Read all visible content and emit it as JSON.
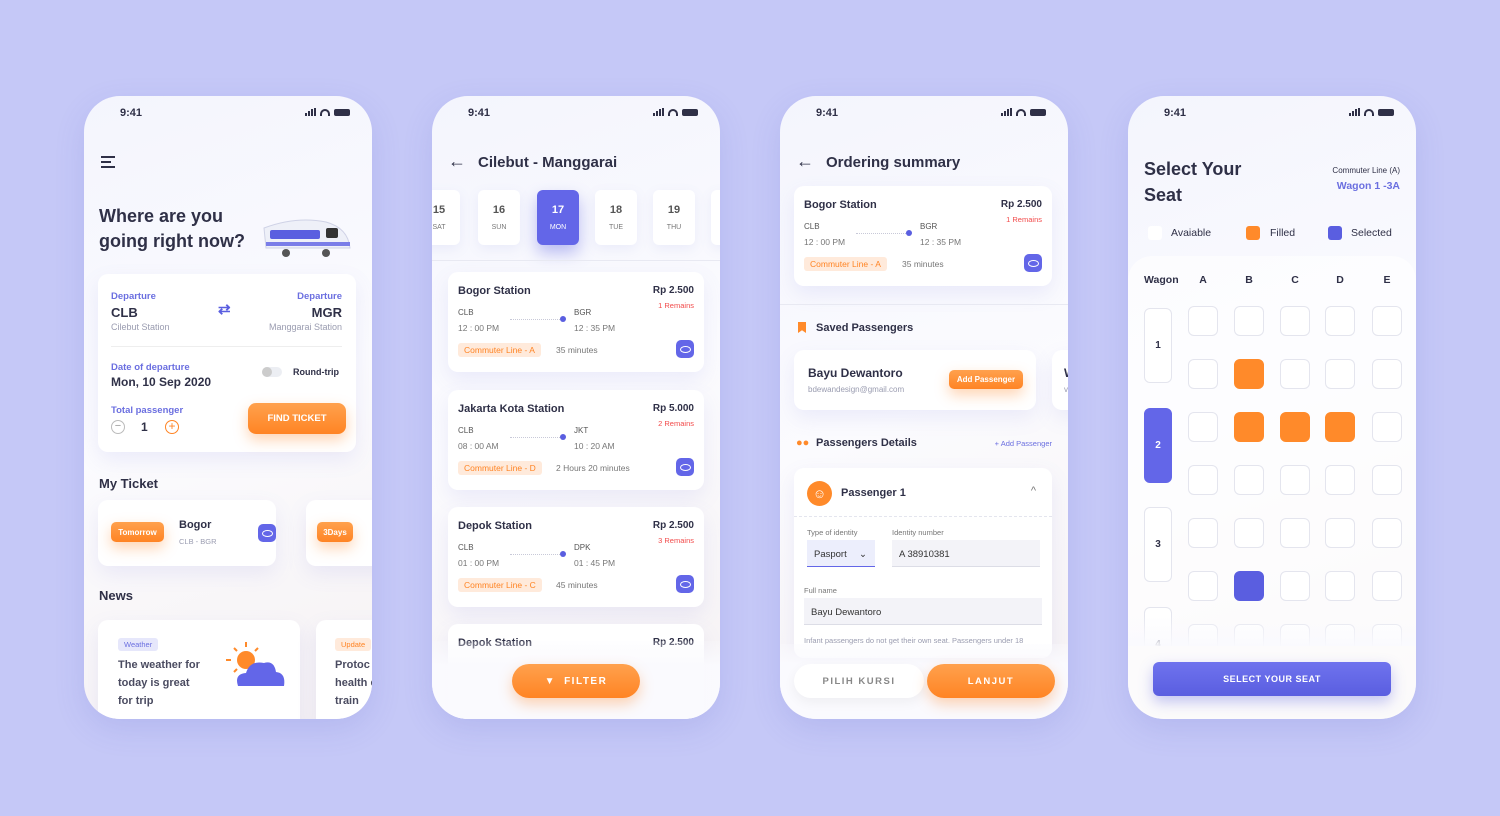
{
  "status_time": "9:41",
  "colors": {
    "background": "#c5c8f7",
    "accent": "#6366e8",
    "orange": "#ff8a2a"
  },
  "home": {
    "menu_icon": "hamburger-icon",
    "title_line1": "Where are you",
    "title_line2": "going right now?",
    "from_label": "Departure",
    "from_code": "CLB",
    "from_station": "Cilebut Station",
    "to_label": "Departure",
    "to_code": "MGR",
    "to_station": "Manggarai Station",
    "date_label": "Date of departure",
    "date_value": "Mon, 10 Sep 2020",
    "round_trip_label": "Round-trip",
    "round_trip_on": false,
    "passenger_label": "Total passenger",
    "passenger_count": "1",
    "find_button": "FIND TICKET",
    "my_ticket_title": "My Ticket",
    "tickets": [
      {
        "badge": "Tomorrow",
        "dest": "Bogor",
        "route": "CLB - BGR"
      },
      {
        "badge": "3Days"
      }
    ],
    "news_title": "News",
    "news": [
      {
        "tag": "Weather",
        "text_l1": "The weather for",
        "text_l2": "today is great",
        "text_l3": "for trip"
      },
      {
        "tag": "Update",
        "text_l1": "Protoc",
        "text_l2": "health c",
        "text_l3": "train"
      }
    ]
  },
  "schedule": {
    "title": "Cilebut - Manggarai",
    "dates": [
      {
        "day": "15",
        "wd": "SAT"
      },
      {
        "day": "16",
        "wd": "SUN"
      },
      {
        "day": "17",
        "wd": "MON",
        "selected": true
      },
      {
        "day": "18",
        "wd": "TUE"
      },
      {
        "day": "19",
        "wd": "THU"
      },
      {
        "day": "",
        "wd": ""
      }
    ],
    "trips": [
      {
        "name": "Bogor Station",
        "price": "Rp 2.500",
        "remains": "1 Remains",
        "from": "CLB",
        "from_time": "12 : 00 PM",
        "to": "BGR",
        "to_time": "12 : 35 PM",
        "line": "Commuter Line - A",
        "duration": "35 minutes"
      },
      {
        "name": "Jakarta Kota Station",
        "price": "Rp 5.000",
        "remains": "2 Remains",
        "from": "CLB",
        "from_time": "08 : 00 AM",
        "to": "JKT",
        "to_time": "10 : 20 AM",
        "line": "Commuter Line - D",
        "duration": "2 Hours 20 minutes"
      },
      {
        "name": "Depok Station",
        "price": "Rp 2.500",
        "remains": "3 Remains",
        "from": "CLB",
        "from_time": "01 : 00 PM",
        "to": "DPK",
        "to_time": "01 : 45 PM",
        "line": "Commuter Line - C",
        "duration": "45 minutes"
      },
      {
        "name": "Depok Station",
        "price": "Rp 2.500"
      }
    ],
    "filter_button": "FILTER"
  },
  "summary": {
    "title": "Ordering summary",
    "trip": {
      "name": "Bogor Station",
      "price": "Rp 2.500",
      "remains": "1 Remains",
      "from": "CLB",
      "from_time": "12 : 00 PM",
      "to": "BGR",
      "to_time": "12 : 35 PM",
      "line": "Commuter Line - A",
      "duration": "35 minutes"
    },
    "saved_title": "Saved Passengers",
    "saved": [
      {
        "name": "Bayu Dewantoro",
        "email": "bdewandesign@gmail.com",
        "action": "Add Passenger"
      },
      {
        "name": "W",
        "email": "v"
      }
    ],
    "details_title": "Passengers Details",
    "add_link": "+ Add Passenger",
    "passenger_title": "Passenger 1",
    "identity_type_label": "Type of identity",
    "identity_type_value": "Pasport",
    "identity_number_label": "Identity number",
    "identity_number_value": "A 38910381",
    "full_name_label": "Full name",
    "full_name_value": "Bayu Dewantoro",
    "note": "Infant passengers do not get their own seat. Passengers under 18",
    "seat_button": "PILIH KURSI",
    "next_button": "LANJUT"
  },
  "seat": {
    "title_l1": "Select Your",
    "title_l2": "Seat",
    "line": "Commuter Line (A)",
    "wagon_sel": "Wagon 1 -3A",
    "legend": {
      "available": "Avaiable",
      "filled": "Filled",
      "selected": "Selected"
    },
    "wagon_header": "Wagon",
    "columns": [
      "A",
      "B",
      "C",
      "D",
      "E"
    ],
    "wagons": [
      {
        "label": "1"
      },
      {
        "label": "2",
        "active": true
      },
      {
        "label": "3"
      },
      {
        "label": "4"
      }
    ],
    "rows": [
      [
        "available",
        "available",
        "available",
        "available",
        "available"
      ],
      [
        "available",
        "filled",
        "available",
        "available",
        "available"
      ],
      [
        "available",
        "filled",
        "filled",
        "filled",
        "available"
      ],
      [
        "available",
        "available",
        "available",
        "available",
        "available"
      ],
      [
        "available",
        "available",
        "available",
        "available",
        "available"
      ],
      [
        "available",
        "selected",
        "available",
        "available",
        "available"
      ],
      [
        "available",
        "available",
        "available",
        "available",
        "available"
      ]
    ],
    "button": "SELECT YOUR SEAT"
  }
}
